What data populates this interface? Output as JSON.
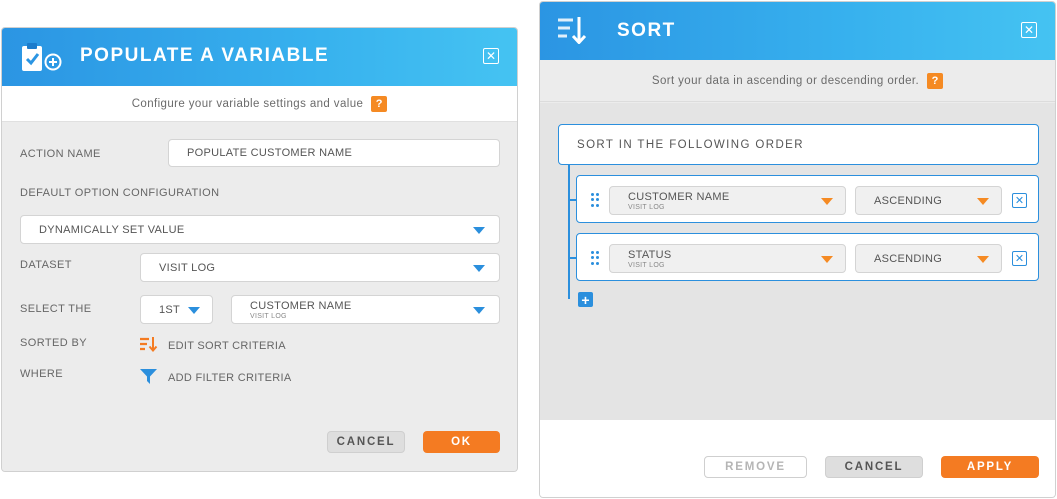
{
  "populate": {
    "title": "POPULATE A VARIABLE",
    "subtitle": "Configure your variable settings and value",
    "help": "?",
    "close": "✕",
    "action_name_label": "ACTION NAME",
    "action_name_value": "POPULATE CUSTOMER NAME",
    "default_option_label": "DEFAULT OPTION CONFIGURATION",
    "default_option_value": "DYNAMICALLY SET VALUE",
    "dataset_label": "DATASET",
    "dataset_value": "VISIT LOG",
    "select_the_label": "SELECT THE",
    "select_the_value": "1ST",
    "field_value": "CUSTOMER NAME",
    "field_sub": "VISIT LOG",
    "sorted_by_label": "SORTED BY",
    "sorted_by_link": "EDIT SORT CRITERIA",
    "where_label": "WHERE",
    "where_link": "ADD FILTER CRITERIA",
    "cancel": "CANCEL",
    "ok": "OK"
  },
  "sort": {
    "title": "SORT",
    "subtitle": "Sort your data in ascending or descending order.",
    "help": "?",
    "close": "✕",
    "order_heading": "SORT IN THE FOLLOWING ORDER",
    "rows": [
      {
        "field": "CUSTOMER NAME",
        "sub": "VISIT LOG",
        "direction": "ASCENDING"
      },
      {
        "field": "STATUS",
        "sub": "VISIT LOG",
        "direction": "ASCENDING"
      }
    ],
    "add": "+",
    "remove": "REMOVE",
    "cancel": "CANCEL",
    "apply": "APPLY"
  },
  "colors": {
    "header_blue": "#2b95e3",
    "accent_orange": "#f47b22",
    "link_blue": "#2b8fdd"
  }
}
